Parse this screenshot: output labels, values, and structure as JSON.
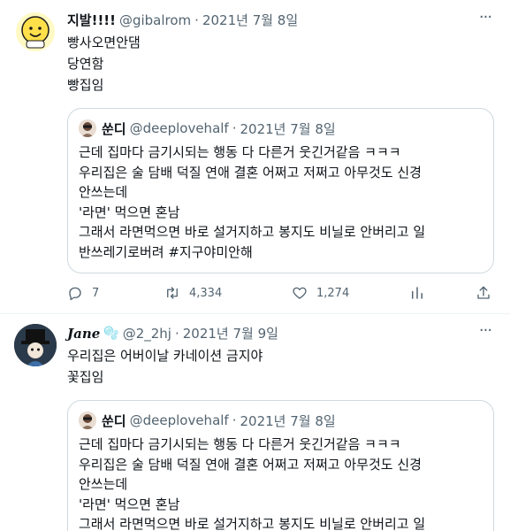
{
  "tweets": [
    {
      "author": {
        "name": "지발!!!!",
        "handle": "@gibalrom",
        "avatar_icon": "yellow-smiley-face-icon"
      },
      "date": "2021년 7월 8일",
      "text": "빵사오면안댐\n당연함\n빵집임",
      "quote": {
        "author": {
          "name": "쑨디",
          "handle": "@deeplovehalf",
          "avatar_icon": "profile-photo-icon"
        },
        "date": "2021년 7월 8일",
        "text": "근데 집마다 금기시되는 행동 다 다른거 웃긴거같음 ㅋㅋㅋ\n우리집은 술 담배 덕질 연애 결혼 어쩌고 저쩌고 아무것도 신경\n안쓰는데\n'라면' 먹으면 혼남\n그래서 라면먹으면 바로 설거지하고 봉지도 비닐로 안버리고 일\n반쓰레기로버려 #지구야미안해"
      },
      "actions": {
        "replies": "7",
        "retweets": "4,334",
        "likes": "1,274"
      }
    },
    {
      "author": {
        "name": "Jane",
        "badge": "🫧",
        "handle": "@2_2hj",
        "avatar_icon": "top-hat-character-icon"
      },
      "date": "2021년 7월 9일",
      "text": "우리집은 어버이날 카네이션 금지야\n꽃집임",
      "quote": {
        "author": {
          "name": "쑨디",
          "handle": "@deeplovehalf",
          "avatar_icon": "profile-photo-icon"
        },
        "date": "2021년 7월 8일",
        "text": "근데 집마다 금기시되는 행동 다 다른거 웃긴거같음 ㅋㅋㅋ\n우리집은 술 담배 덕질 연애 결혼 어쩌고 저쩌고 아무것도 신경\n안쓰는데\n'라면' 먹으면 혼남\n그래서 라면먹으면 바로 설거지하고 봉지도 비닐로 안버리고 일"
      }
    }
  ],
  "separator": "·",
  "more_label": "···",
  "colors": {
    "text": "#0f1419",
    "secondary": "#536471",
    "border": "#cfd9de"
  }
}
